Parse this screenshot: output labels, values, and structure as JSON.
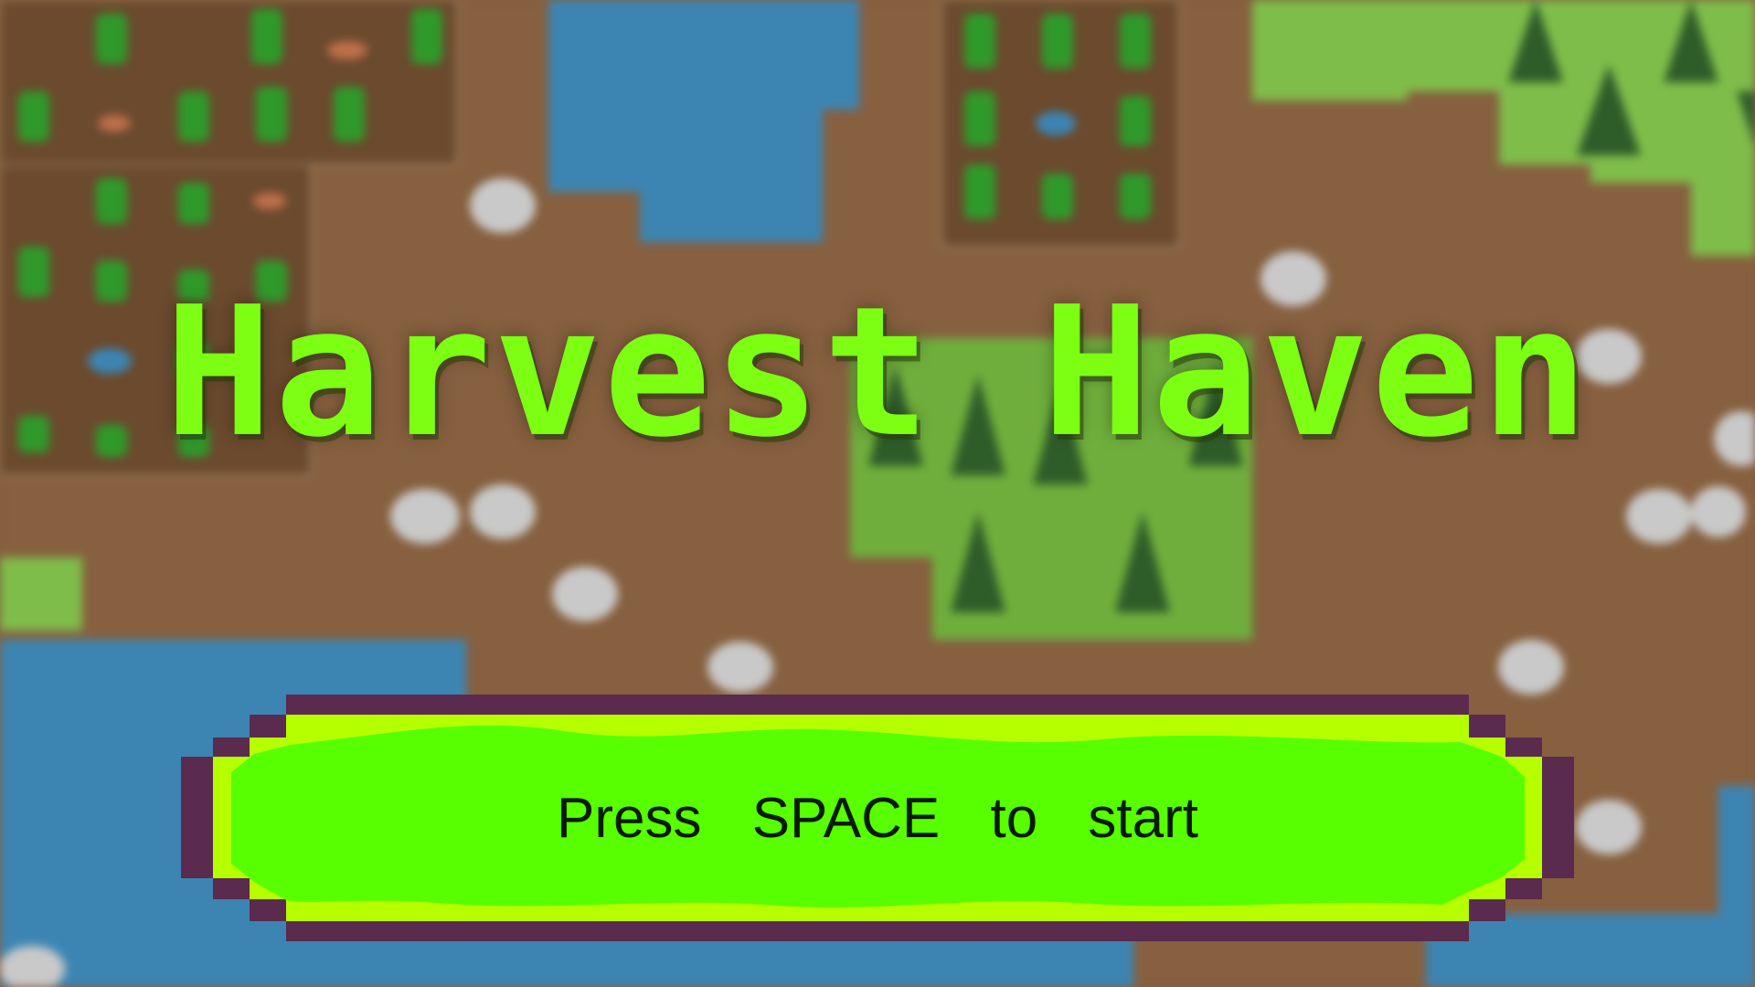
{
  "game": {
    "title": "Harvest Haven",
    "prompt": "Press SPACE to start"
  },
  "colors": {
    "title_green": "#7cff12",
    "panel_green": "#57ff00",
    "panel_highlight": "#b6ff00",
    "panel_border": "#5a2b4e",
    "dirt": "#86603f",
    "grass": "#7fbd4a",
    "water": "#3c85b3"
  },
  "scene": {
    "background": "blurred top-down farm map",
    "icons": [
      "crop-icon",
      "tree-icon",
      "rock-icon",
      "water-tile"
    ]
  }
}
